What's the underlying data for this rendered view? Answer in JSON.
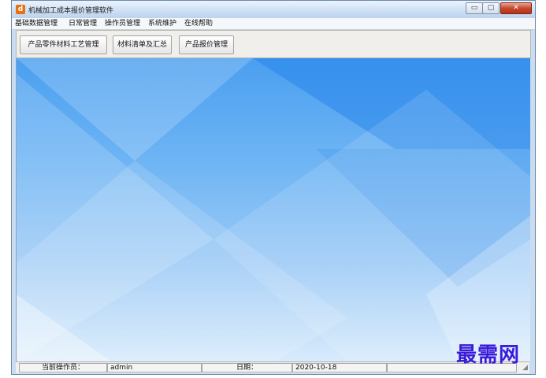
{
  "window": {
    "title": "机械加工成本报价管理软件",
    "app_icon_glyph": "d",
    "controls": {
      "minimize": "▭",
      "maximize": "▢",
      "close": "✕"
    }
  },
  "menubar": {
    "items": [
      {
        "label": "基础数据管理"
      },
      {
        "label": "日常管理"
      },
      {
        "label": "操作员管理"
      },
      {
        "label": "系统维护"
      },
      {
        "label": "在线帮助"
      }
    ]
  },
  "toolbar": {
    "buttons": [
      {
        "label": "产品零件材料工艺管理"
      },
      {
        "label": "材料清单及汇总"
      },
      {
        "label": "产品报价管理"
      }
    ]
  },
  "statusbar": {
    "operator_label": "当前操作员：",
    "operator_value": "admin",
    "date_label": "日期：",
    "date_value": "2020-10-18"
  },
  "watermark": {
    "text": "最需网"
  },
  "colors": {
    "accent": "#e8700e",
    "canvas_top": "#4a9ff0",
    "canvas_bottom": "#d8ebfc",
    "watermark": "#3a1bd8"
  }
}
